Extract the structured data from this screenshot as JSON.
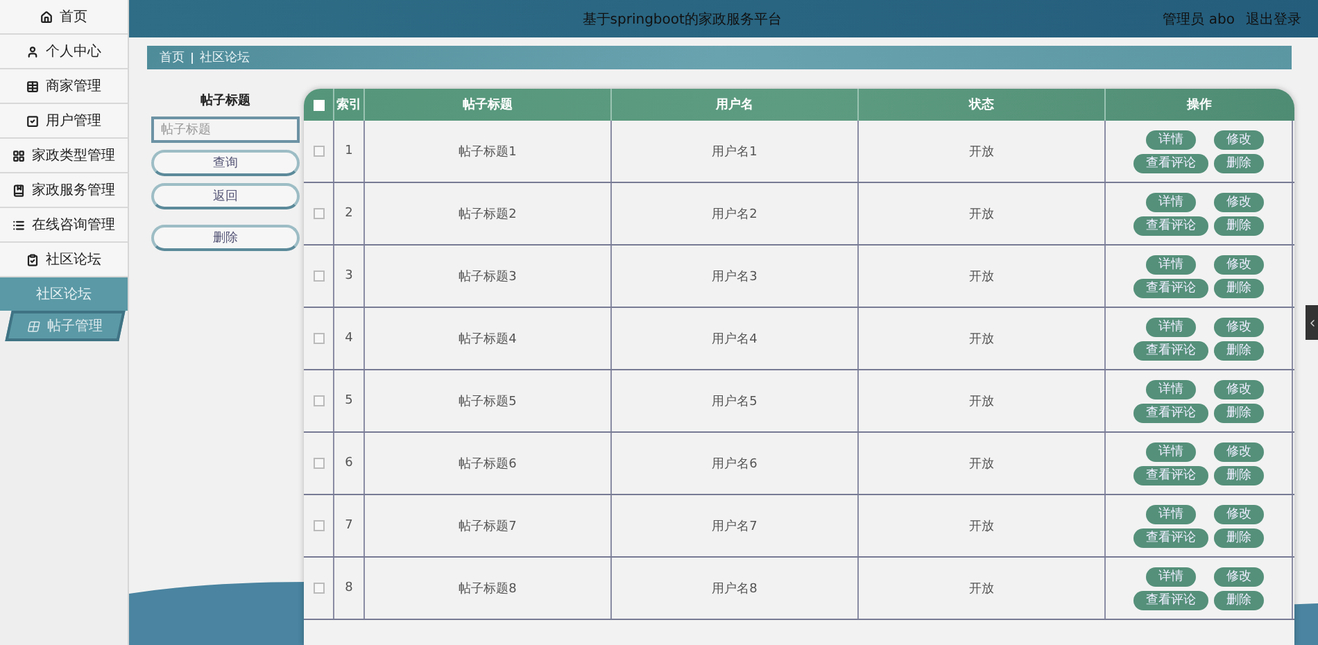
{
  "header": {
    "title": "基于springboot的家政服务平台",
    "user": "管理员 abo",
    "logout": "退出登录"
  },
  "sidebar": {
    "items": [
      {
        "label": "首页"
      },
      {
        "label": "个人中心"
      },
      {
        "label": "商家管理"
      },
      {
        "label": "用户管理"
      },
      {
        "label": "家政类型管理"
      },
      {
        "label": "家政服务管理"
      },
      {
        "label": "在线咨询管理"
      },
      {
        "label": "社区论坛"
      }
    ],
    "submenu": {
      "title": "社区论坛",
      "items": [
        {
          "label": "帖子管理",
          "selected": true
        }
      ]
    }
  },
  "breadcrumb": [
    "首页",
    "社区论坛"
  ],
  "search": {
    "label": "帖子标题",
    "placeholder": "帖子标题",
    "buttons": [
      "查询",
      "返回",
      "删除"
    ]
  },
  "table": {
    "select_all_checked": false,
    "columns": [
      "索引",
      "帖子标题",
      "用户名",
      "状态",
      "操作"
    ],
    "rows": [
      {
        "checked": false,
        "index": "1",
        "title": "帖子标题1",
        "user": "用户名1",
        "status": "开放",
        "actions": [
          "详情",
          "修改",
          "查看评论",
          "删除"
        ]
      },
      {
        "checked": false,
        "index": "2",
        "title": "帖子标题2",
        "user": "用户名2",
        "status": "开放",
        "actions": [
          "详情",
          "修改",
          "查看评论",
          "删除"
        ]
      },
      {
        "checked": false,
        "index": "3",
        "title": "帖子标题3",
        "user": "用户名3",
        "status": "开放",
        "actions": [
          "详情",
          "修改",
          "查看评论",
          "删除"
        ]
      },
      {
        "checked": false,
        "index": "4",
        "title": "帖子标题4",
        "user": "用户名4",
        "status": "开放",
        "actions": [
          "详情",
          "修改",
          "查看评论",
          "删除"
        ]
      },
      {
        "checked": false,
        "index": "5",
        "title": "帖子标题5",
        "user": "用户名5",
        "status": "开放",
        "actions": [
          "详情",
          "修改",
          "查看评论",
          "删除"
        ]
      },
      {
        "checked": false,
        "index": "6",
        "title": "帖子标题6",
        "user": "用户名6",
        "status": "开放",
        "actions": [
          "详情",
          "修改",
          "查看评论",
          "删除"
        ]
      },
      {
        "checked": false,
        "index": "7",
        "title": "帖子标题7",
        "user": "用户名7",
        "status": "开放",
        "actions": [
          "详情",
          "修改",
          "查看评论",
          "删除"
        ]
      },
      {
        "checked": false,
        "index": "8",
        "title": "帖子标题8",
        "user": "用户名8",
        "status": "开放",
        "actions": [
          "详情",
          "修改",
          "查看评论",
          "删除"
        ]
      }
    ]
  }
}
